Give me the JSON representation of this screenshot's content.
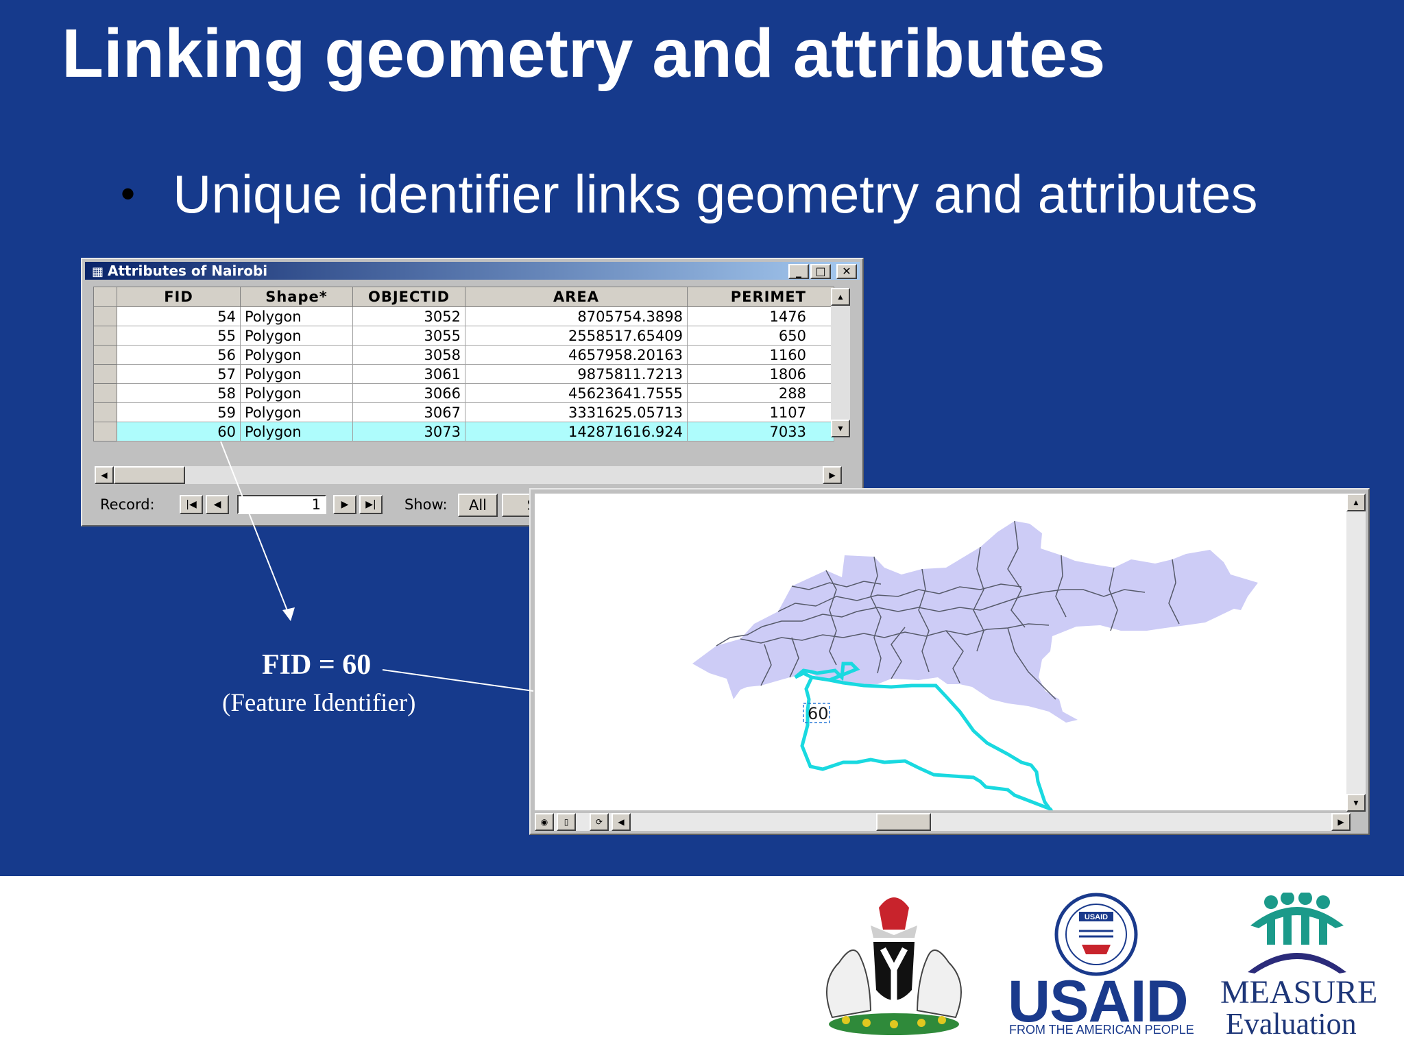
{
  "slide": {
    "title": "Linking geometry and attributes",
    "bullet": "Unique identifier links geometry and attributes"
  },
  "attributes_window": {
    "title": "Attributes of Nairobi",
    "columns": [
      "FID",
      "Shape*",
      "OBJECTID",
      "AREA",
      "PERIMET"
    ],
    "rows": [
      {
        "fid": "54",
        "shape": "Polygon",
        "objectid": "3052",
        "area": "8705754.3898",
        "perimeter": "1476"
      },
      {
        "fid": "55",
        "shape": "Polygon",
        "objectid": "3055",
        "area": "2558517.65409",
        "perimeter": "650"
      },
      {
        "fid": "56",
        "shape": "Polygon",
        "objectid": "3058",
        "area": "4657958.20163",
        "perimeter": "1160"
      },
      {
        "fid": "57",
        "shape": "Polygon",
        "objectid": "3061",
        "area": "9875811.7213",
        "perimeter": "1806"
      },
      {
        "fid": "58",
        "shape": "Polygon",
        "objectid": "3066",
        "area": "45623641.7555",
        "perimeter": "288"
      },
      {
        "fid": "59",
        "shape": "Polygon",
        "objectid": "3067",
        "area": "3331625.05713",
        "perimeter": "1107"
      },
      {
        "fid": "60",
        "shape": "Polygon",
        "objectid": "3073",
        "area": "142871616.924",
        "perimeter": "7033"
      }
    ],
    "selected_fid": "60",
    "record_label": "Record:",
    "record_value": "1",
    "show_label": "Show:",
    "show_all": "All",
    "show_selected": "Se"
  },
  "map_window": {
    "feature_label": "60",
    "fill_color": "#cdccf6",
    "highlight_color": "#19d9e0"
  },
  "callout": {
    "fid_text": "FID = 60",
    "fid_sub": "(Feature Identifier)"
  },
  "logos": {
    "usaid": "USAID",
    "usaid_sub": "FROM THE AMERICAN PEOPLE",
    "usaid_seal_text": "USAID",
    "measure_line1": "MEASURE",
    "measure_line2": "Evaluation"
  },
  "colors": {
    "slide_bg": "#163a8c",
    "highlight_row": "#aefcfc"
  }
}
